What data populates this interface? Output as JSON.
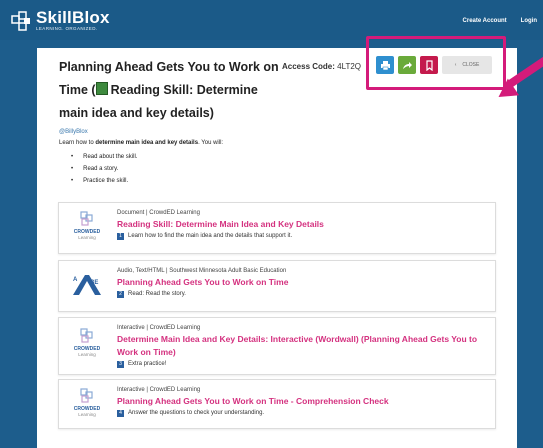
{
  "header": {
    "logo_name": "SkillBlox",
    "logo_tagline": "LEARNING. ORGANIZED.",
    "create_account": "Create Account",
    "login": "Login"
  },
  "page": {
    "title": "Planning Ahead Gets You to Work on Time (",
    "title_icon": "book-icon",
    "title_rest": "Reading Skill: Determine main idea and key details)",
    "access_label": "Access Code:",
    "access_code": "4LT2Q",
    "handle": "@BillyBlox",
    "intro_pre": "Learn how to ",
    "intro_bold": "determine main idea and key details",
    "intro_post": ". You will:",
    "bullets": [
      "Read about the skill.",
      "Read a story.",
      "Practice the skill."
    ]
  },
  "toolbar": {
    "print_icon": "print-icon",
    "share_icon": "share-icon",
    "bookmark_icon": "bookmark-icon",
    "close_label": "CLOSE"
  },
  "colors": {
    "header_bg": "#1b5a88",
    "accent_pink": "#d4317f",
    "highlight": "#d41b7a",
    "print": "#2e8fcf",
    "share": "#6aaa3a",
    "bookmark": "#c41a4c"
  },
  "cards": [
    {
      "meta": "Document | CrowdED Learning",
      "title": "Reading Skill: Determine Main Idea and Key Details",
      "num": "1",
      "desc": "Learn how to find the main idea and the details that support it.",
      "logo": "crowded-logo"
    },
    {
      "meta": "Audio, Text/HTML | Southwest Minnesota Adult Basic Education",
      "title": "Planning Ahead Gets You to Work on Time",
      "num": "2",
      "desc": "Read: Read the story.",
      "logo": "abe-logo"
    },
    {
      "meta": "Interactive | CrowdED Learning",
      "title": "Determine Main Idea and Key Details: Interactive (Wordwall) (Planning Ahead Gets You to Work on Time)",
      "num": "3",
      "desc": "Extra practice!",
      "logo": "crowded-logo"
    },
    {
      "meta": "Interactive | CrowdED Learning",
      "title": "Planning Ahead Gets You to Work on Time - Comprehension Check",
      "num": "4",
      "desc": "Answer the questions to check your understanding.",
      "logo": "crowded-logo"
    }
  ]
}
